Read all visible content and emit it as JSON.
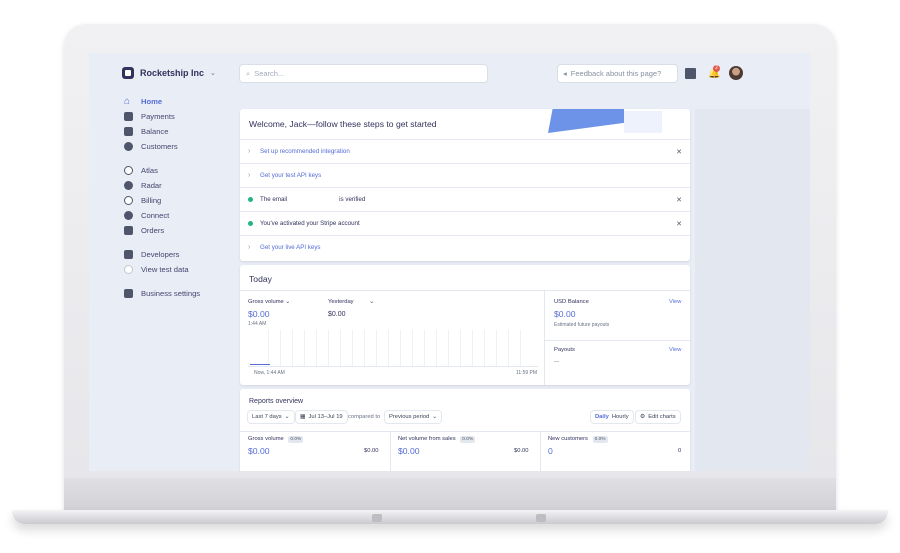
{
  "account": {
    "name": "Rocketship Inc"
  },
  "sidebar": {
    "items": [
      {
        "label": "Home"
      },
      {
        "label": "Payments"
      },
      {
        "label": "Balance"
      },
      {
        "label": "Customers"
      },
      {
        "label": "Atlas"
      },
      {
        "label": "Radar"
      },
      {
        "label": "Billing"
      },
      {
        "label": "Connect"
      },
      {
        "label": "Orders"
      },
      {
        "label": "Developers"
      },
      {
        "label": "View test data"
      },
      {
        "label": "Business settings"
      }
    ]
  },
  "topbar": {
    "search_placeholder": "Search...",
    "feedback_label": "Feedback about this page?",
    "notification_count": "2"
  },
  "welcome": {
    "title": "Welcome, Jack—follow these steps to get started",
    "steps": [
      {
        "label": "Set up recommended integration",
        "status": "pending"
      },
      {
        "label": "Get your test API keys",
        "status": "pending"
      },
      {
        "label": "The email",
        "suffix": "is verified",
        "status": "done"
      },
      {
        "label": "You've activated your Stripe account",
        "status": "done"
      },
      {
        "label": "Get your live API keys",
        "status": "pending"
      }
    ]
  },
  "today": {
    "title": "Today",
    "gross_volume_label": "Gross volume",
    "gross_volume_value": "$0.00",
    "gross_volume_time": "1:44 AM",
    "yesterday_label": "Yesterday",
    "yesterday_value": "$0.00",
    "axis_start": "Now, 1:44 AM",
    "axis_end": "11:59 PM",
    "usd_balance_label": "USD Balance",
    "usd_balance_value": "$0.00",
    "usd_balance_note": "Estimated future payouts",
    "payouts_label": "Payouts",
    "payouts_value": "—",
    "view_label": "View"
  },
  "reports": {
    "title": "Reports overview",
    "range_select": "Last 7 days",
    "date_range": "Jul 13–Jul 19",
    "compared_to": "compared to",
    "compare_select": "Previous period",
    "daily_label": "Daily",
    "hourly_label": "Hourly",
    "edit_charts_label": "Edit charts",
    "metrics": [
      {
        "label": "Gross volume",
        "change": "0.0%",
        "value": "$0.00",
        "previous": "$0.00"
      },
      {
        "label": "Net volume from sales",
        "change": "0.0%",
        "value": "$0.00",
        "previous": "$0.00"
      },
      {
        "label": "New customers",
        "change": "0.0%",
        "value": "0",
        "previous": "0"
      }
    ]
  },
  "colors": {
    "accent": "#556cd6",
    "success": "#24b47e",
    "text": "#32325d"
  }
}
